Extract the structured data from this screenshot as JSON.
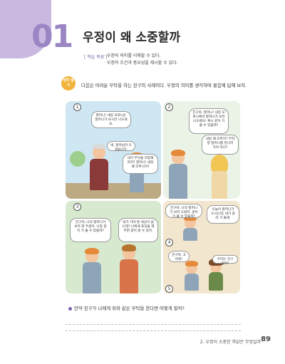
{
  "colors": {
    "accent": "#9b86c4",
    "badge": "#f2b33a"
  },
  "chapter": {
    "number": "01",
    "title": "우정이 왜 소중할까"
  },
  "goals": {
    "tag": "[ 학습 목표 ]",
    "items": [
      "· 우정의 의미를 이해할 수 있다.",
      "· 우정의 조건과 중요성을 제시할 수 있다."
    ]
  },
  "activity": {
    "badge": "생각 열기",
    "instruction": "다음은 어려운 부탁을 하는 친구의 사례이다. 우정의 의미를 생각하며 물음에 답해 보자."
  },
  "panels": [
    {
      "number": "1",
      "bubbles": [
        "할머니! 내일 모로니는 할머니가 보시러 나오세요.",
        "네, 할머님이 오셨습니다.",
        "내가 무엇을 걱정해야지? 할머니! 내일 왜 모르시지?"
      ]
    },
    {
      "number": "2",
      "bubbles": [
        "친구야, 할머니! 내일 모로니에서 할머니가 보러 나오세요! 혹시 같이 가 줄 수 있을까?",
        "내일 왜 모르지? 무작정 할머니를 만나러 가야 하나?"
      ]
    },
    {
      "number": "3",
      "bubbles": [
        "친구야, 나의 할머니가 보러 와 주셨어. 나랑 같이 가 줄 수 있을까?",
        "내가 가야 할 세상이 없는데? 나에게 포장을 해 주면 같이 갈 수 있어."
      ]
    },
    {
      "number": "4",
      "bubbles": [
        "친구야, 나의 할머니가 보러 오셨어. 같이 가 줄 수 있을까?",
        "오늘이 할머니가 오시는데, 내가 같이 가 줄게.",
        "친구야, 고마워!",
        "우리는 친구잖아!"
      ]
    },
    {
      "number": "5"
    }
  ],
  "question": "만약 친구가 나에게 위와 같은 부탁을 한다면 어떻게 할까?",
  "footer": {
    "section": "2. 우정이 소중한 까닭은 무엇일까",
    "page": "89"
  }
}
